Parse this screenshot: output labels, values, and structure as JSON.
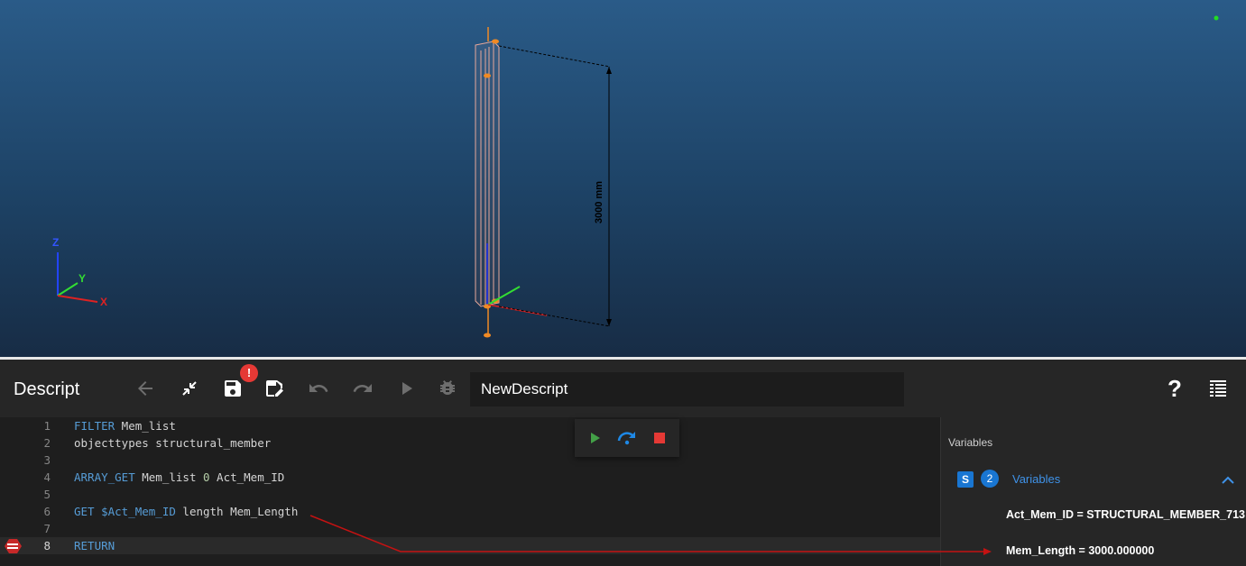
{
  "viewport": {
    "dimension_label": "3000 mm",
    "axis_labels": {
      "x": "X",
      "y": "Y",
      "z": "Z"
    },
    "colors": {
      "grid": "#d8dfe8",
      "member": "#e8a89a",
      "node": "#f08a24"
    }
  },
  "toolbar": {
    "title": "Descript",
    "save_badge": "!",
    "descript_name": "NewDescript",
    "help_label": "?",
    "icons": [
      "back-arrow-icon",
      "collapse-icon",
      "save-icon",
      "save-as-icon",
      "undo-icon",
      "redo-icon",
      "play-icon",
      "debug-icon",
      "list-icon"
    ]
  },
  "editor": {
    "lines": [
      {
        "num": "1",
        "kw": "FILTER",
        "rest": " Mem_list"
      },
      {
        "num": "2",
        "kw": "",
        "rest": "objecttypes structural_member"
      },
      {
        "num": "3",
        "kw": "",
        "rest": ""
      },
      {
        "num": "4",
        "kw": "ARRAY_GET",
        "rest": " Mem_list ",
        "numtok": "0",
        "tail": " Act_Mem_ID"
      },
      {
        "num": "5",
        "kw": "",
        "rest": ""
      },
      {
        "num": "6",
        "kw": "GET $Act_Mem_ID",
        "rest": " length Mem_Length"
      },
      {
        "num": "7",
        "kw": "",
        "rest": ""
      },
      {
        "num": "8",
        "kw": "RETURN",
        "rest": ""
      }
    ],
    "active_line": "8"
  },
  "run_controls": {
    "icons": [
      "run-icon",
      "step-over-icon",
      "stop-icon"
    ],
    "colors": {
      "run": "#43a047",
      "step": "#1e88e5",
      "stop": "#e53935"
    }
  },
  "variables": {
    "header": "Variables",
    "scope_badge": "S",
    "count": "2",
    "group_label": "Variables",
    "items": [
      "Act_Mem_ID = STRUCTURAL_MEMBER_713",
      "Mem_Length = 3000.000000"
    ]
  }
}
